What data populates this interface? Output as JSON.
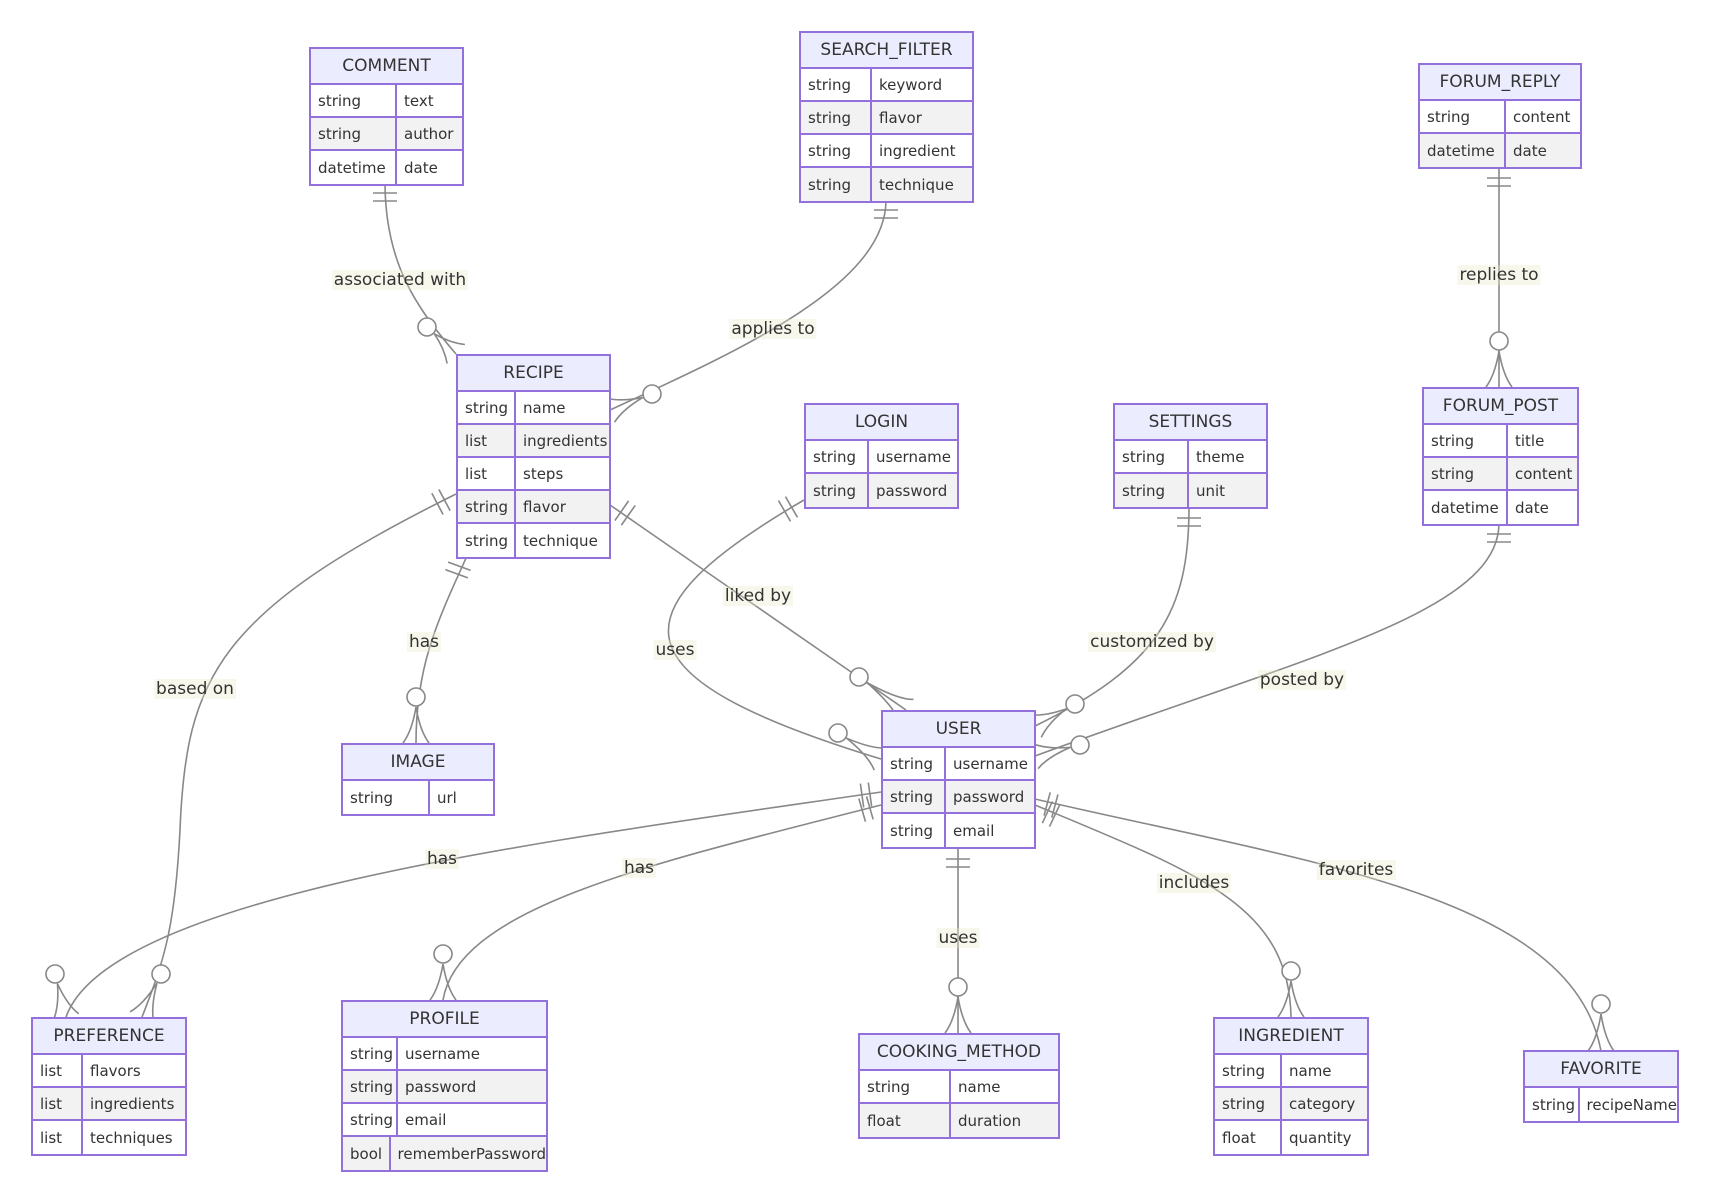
{
  "diagram": {
    "type": "entity-relationship",
    "entities": [
      {
        "id": "COMMENT",
        "name": "COMMENT",
        "attributes": [
          {
            "type": "string",
            "name": "text"
          },
          {
            "type": "string",
            "name": "author"
          },
          {
            "type": "datetime",
            "name": "date"
          }
        ]
      },
      {
        "id": "SEARCH_FILTER",
        "name": "SEARCH_FILTER",
        "attributes": [
          {
            "type": "string",
            "name": "keyword"
          },
          {
            "type": "string",
            "name": "flavor"
          },
          {
            "type": "string",
            "name": "ingredient"
          },
          {
            "type": "string",
            "name": "technique"
          }
        ]
      },
      {
        "id": "FORUM_REPLY",
        "name": "FORUM_REPLY",
        "attributes": [
          {
            "type": "string",
            "name": "content"
          },
          {
            "type": "datetime",
            "name": "date"
          }
        ]
      },
      {
        "id": "RECIPE",
        "name": "RECIPE",
        "attributes": [
          {
            "type": "string",
            "name": "name"
          },
          {
            "type": "list",
            "name": "ingredients"
          },
          {
            "type": "list",
            "name": "steps"
          },
          {
            "type": "string",
            "name": "flavor"
          },
          {
            "type": "string",
            "name": "technique"
          }
        ]
      },
      {
        "id": "LOGIN",
        "name": "LOGIN",
        "attributes": [
          {
            "type": "string",
            "name": "username"
          },
          {
            "type": "string",
            "name": "password"
          }
        ]
      },
      {
        "id": "SETTINGS",
        "name": "SETTINGS",
        "attributes": [
          {
            "type": "string",
            "name": "theme"
          },
          {
            "type": "string",
            "name": "unit"
          }
        ]
      },
      {
        "id": "FORUM_POST",
        "name": "FORUM_POST",
        "attributes": [
          {
            "type": "string",
            "name": "title"
          },
          {
            "type": "string",
            "name": "content"
          },
          {
            "type": "datetime",
            "name": "date"
          }
        ]
      },
      {
        "id": "IMAGE",
        "name": "IMAGE",
        "attributes": [
          {
            "type": "string",
            "name": "url"
          }
        ]
      },
      {
        "id": "USER",
        "name": "USER",
        "attributes": [
          {
            "type": "string",
            "name": "username"
          },
          {
            "type": "string",
            "name": "password"
          },
          {
            "type": "string",
            "name": "email"
          }
        ]
      },
      {
        "id": "PREFERENCE",
        "name": "PREFERENCE",
        "attributes": [
          {
            "type": "list",
            "name": "flavors"
          },
          {
            "type": "list",
            "name": "ingredients"
          },
          {
            "type": "list",
            "name": "techniques"
          }
        ]
      },
      {
        "id": "PROFILE",
        "name": "PROFILE",
        "attributes": [
          {
            "type": "string",
            "name": "username"
          },
          {
            "type": "string",
            "name": "password"
          },
          {
            "type": "string",
            "name": "email"
          },
          {
            "type": "bool",
            "name": "rememberPassword"
          }
        ]
      },
      {
        "id": "COOKING_METHOD",
        "name": "COOKING_METHOD",
        "attributes": [
          {
            "type": "string",
            "name": "name"
          },
          {
            "type": "float",
            "name": "duration"
          }
        ]
      },
      {
        "id": "INGREDIENT",
        "name": "INGREDIENT",
        "attributes": [
          {
            "type": "string",
            "name": "name"
          },
          {
            "type": "string",
            "name": "category"
          },
          {
            "type": "float",
            "name": "quantity"
          }
        ]
      },
      {
        "id": "FAVORITE",
        "name": "FAVORITE",
        "attributes": [
          {
            "type": "string",
            "name": "recipeName"
          }
        ]
      }
    ],
    "relationships": [
      {
        "from": "COMMENT",
        "to": "RECIPE",
        "label": "associated with",
        "from_card": "exactly-one",
        "to_card": "zero-or-many"
      },
      {
        "from": "SEARCH_FILTER",
        "to": "RECIPE",
        "label": "applies to",
        "from_card": "exactly-one",
        "to_card": "zero-or-many"
      },
      {
        "from": "FORUM_REPLY",
        "to": "FORUM_POST",
        "label": "replies to",
        "from_card": "exactly-one",
        "to_card": "zero-or-many"
      },
      {
        "from": "RECIPE",
        "to": "IMAGE",
        "label": "has",
        "from_card": "exactly-one",
        "to_card": "zero-or-many"
      },
      {
        "from": "RECIPE",
        "to": "USER",
        "label": "liked by",
        "from_card": "exactly-one",
        "to_card": "zero-or-many"
      },
      {
        "from": "RECIPE",
        "to": "PREFERENCE",
        "label": "based on",
        "from_card": "exactly-one",
        "to_card": "zero-or-many"
      },
      {
        "from": "LOGIN",
        "to": "USER",
        "label": "uses",
        "from_card": "exactly-one",
        "to_card": "zero-or-many"
      },
      {
        "from": "SETTINGS",
        "to": "USER",
        "label": "customized by",
        "from_card": "exactly-one",
        "to_card": "zero-or-many"
      },
      {
        "from": "FORUM_POST",
        "to": "USER",
        "label": "posted by",
        "from_card": "exactly-one",
        "to_card": "zero-or-many"
      },
      {
        "from": "USER",
        "to": "PREFERENCE",
        "label": "has",
        "from_card": "exactly-one",
        "to_card": "zero-or-many"
      },
      {
        "from": "USER",
        "to": "PROFILE",
        "label": "has",
        "from_card": "exactly-one",
        "to_card": "zero-or-many"
      },
      {
        "from": "USER",
        "to": "COOKING_METHOD",
        "label": "uses",
        "from_card": "exactly-one",
        "to_card": "zero-or-many"
      },
      {
        "from": "USER",
        "to": "INGREDIENT",
        "label": "includes",
        "from_card": "exactly-one",
        "to_card": "zero-or-many"
      },
      {
        "from": "USER",
        "to": "FAVORITE",
        "label": "favorites",
        "from_card": "exactly-one",
        "to_card": "zero-or-many"
      }
    ]
  },
  "colors": {
    "entity_border": "#9370db",
    "entity_header": "#ececff",
    "row_alt": "#f2f2f2",
    "edge": "#888888",
    "text": "#333333"
  }
}
